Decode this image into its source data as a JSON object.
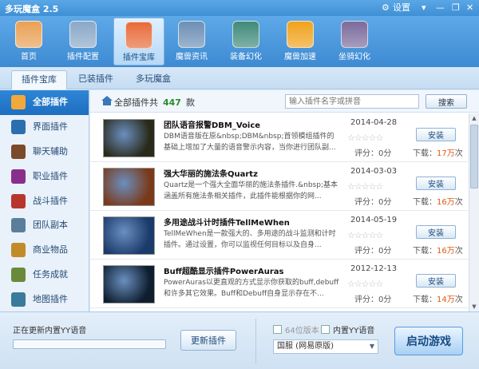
{
  "window": {
    "title": "多玩魔盒 2.5",
    "right_label": "设置"
  },
  "toolbar": {
    "items": [
      {
        "label": "首页",
        "icon": "home-icon",
        "color": "#e9a054"
      },
      {
        "label": "插件配置",
        "icon": "disc-gear-icon",
        "color": "#8aa8c8"
      },
      {
        "label": "插件宝库",
        "icon": "plugin-grid-icon",
        "color": "#e86b3a"
      },
      {
        "label": "魔兽资讯",
        "icon": "news-icon",
        "color": "#6c8fb5"
      },
      {
        "label": "装备幻化",
        "icon": "armor-icon",
        "color": "#3f8a7a"
      },
      {
        "label": "魔兽加速",
        "icon": "lightning-icon",
        "color": "#f0a21b"
      },
      {
        "label": "坐骑幻化",
        "icon": "skull-mount-icon",
        "color": "#7a6b9b"
      }
    ],
    "active_index": 2
  },
  "tabs": {
    "items": [
      "插件宝库",
      "已装插件",
      "多玩魔盒"
    ],
    "active_index": 0
  },
  "sidebar": {
    "items": [
      {
        "label": "全部插件",
        "icon": "book-icon",
        "color": "#f2a93b"
      },
      {
        "label": "界面插件",
        "icon": "interface-icon",
        "color": "#2c6fae"
      },
      {
        "label": "聊天辅助",
        "icon": "chat-icon",
        "color": "#7a4a2a"
      },
      {
        "label": "职业插件",
        "icon": "class-icon",
        "color": "#8a2e8c"
      },
      {
        "label": "战斗插件",
        "icon": "combat-icon",
        "color": "#b8352e"
      },
      {
        "label": "团队副本",
        "icon": "raid-icon",
        "color": "#5b7e9a"
      },
      {
        "label": "商业物品",
        "icon": "trade-icon",
        "color": "#c28b2a"
      },
      {
        "label": "任务成就",
        "icon": "quest-icon",
        "color": "#6a8a3a"
      },
      {
        "label": "地图插件",
        "icon": "map-icon",
        "color": "#3a7a9a"
      }
    ],
    "active_index": 0
  },
  "list_header": {
    "prefix": "全部插件共",
    "count": "447",
    "suffix": "款"
  },
  "search": {
    "placeholder": "输入插件名字或拼音",
    "button_label": "搜索"
  },
  "plugins": [
    {
      "title": "团队语音报警DBM_Voice",
      "desc": "DBM语音版在原&nbsp;DBM&nbsp;首领模组插件的基础上增加了大量的语音警示内容，当你进行团队副...",
      "date": "2014-04-28",
      "rating": "评分：0分",
      "dl_prefix": "下载：",
      "downloads": "17万",
      "dl_suffix": "次",
      "install_label": "安装",
      "thumb_color": "#2a2a1a"
    },
    {
      "title": "强大华丽的施法条Quartz",
      "desc": "Quartz是一个强大全面华丽的施法条插件.&nbsp;基本涵盖所有施法条相关插件，此插件能根据你的网...",
      "date": "2014-03-03",
      "rating": "评分：0分",
      "dl_prefix": "下载：",
      "downloads": "16万",
      "dl_suffix": "次",
      "install_label": "安装",
      "thumb_color": "#7a3a1a"
    },
    {
      "title": "多用途战斗计时插件TellMeWhen",
      "desc": "TellMeWhen是一款强大的、多用途的战斗监测和计时插件。通过设置，你可以监视任何目标以及自身...",
      "date": "2014-05-19",
      "rating": "评分：0分",
      "dl_prefix": "下载：",
      "downloads": "16万",
      "dl_suffix": "次",
      "install_label": "安装",
      "thumb_color": "#1a3a6a"
    },
    {
      "title": "Buff超酷显示插件PowerAuras",
      "desc": "PowerAuras以更直观的方式显示你获取的buff,debuff和许多其它效果。Buff和Debuff自身显示存在不...",
      "date": "2012-12-13",
      "rating": "评分：0分",
      "dl_prefix": "下载：",
      "downloads": "14万",
      "dl_suffix": "次",
      "install_label": "安装",
      "thumb_color": "#0e1e2e"
    }
  ],
  "bottom": {
    "update_text": "正在更新内置YY语音",
    "progress": 0.0,
    "update_button": "更新插件",
    "checkbox_64": "64位版本",
    "checkbox_yy": "内置YY语音",
    "server": "国服 (网易原版)",
    "start_button": "启动游戏"
  }
}
